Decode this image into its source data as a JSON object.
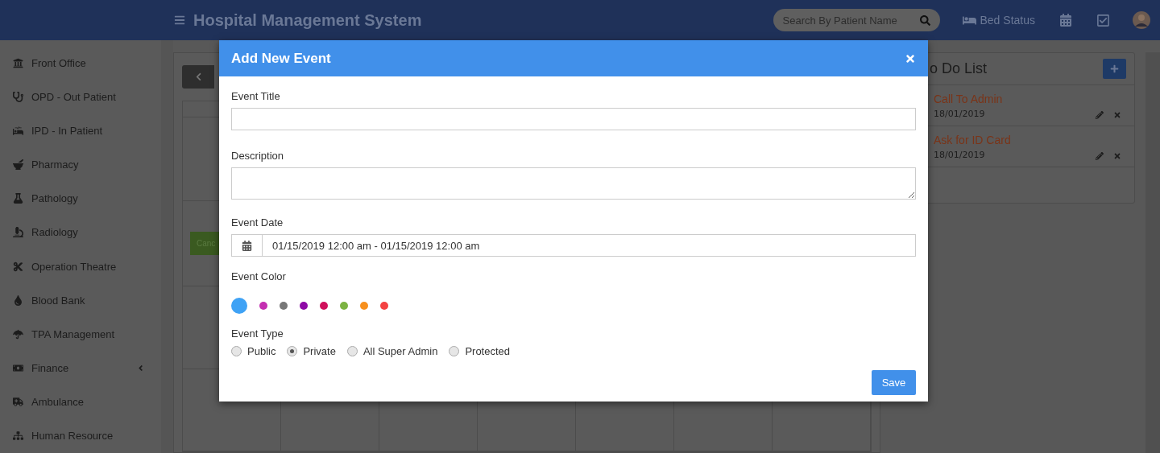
{
  "header": {
    "title": "Hospital Management System",
    "search": {
      "placeholder": "Search By Patient Name"
    },
    "bed_status": "Bed Status"
  },
  "sidebar": {
    "items": [
      {
        "label": "Front Office",
        "expandable": false
      },
      {
        "label": "OPD - Out Patient",
        "expandable": false
      },
      {
        "label": "IPD - In Patient",
        "expandable": false
      },
      {
        "label": "Pharmacy",
        "expandable": false
      },
      {
        "label": "Pathology",
        "expandable": false
      },
      {
        "label": "Radiology",
        "expandable": false
      },
      {
        "label": "Operation Theatre",
        "expandable": false
      },
      {
        "label": "Blood Bank",
        "expandable": false
      },
      {
        "label": "TPA Management",
        "expandable": false
      },
      {
        "label": "Finance",
        "expandable": true
      },
      {
        "label": "Ambulance",
        "expandable": false
      },
      {
        "label": "Human Resource",
        "expandable": false
      }
    ]
  },
  "calendar": {
    "event_button": "Canc"
  },
  "todo": {
    "title": "o Do List",
    "items": [
      {
        "title": "Call To Admin",
        "date": "18/01/2019"
      },
      {
        "title": "Ask for ID Card",
        "date": "18/01/2019"
      }
    ]
  },
  "modal": {
    "title": "Add New Event",
    "event_title": {
      "label": "Event Title"
    },
    "description": {
      "label": "Description"
    },
    "event_date": {
      "label": "Event Date",
      "value": "01/15/2019 12:00 am - 01/15/2019 12:00 am"
    },
    "event_color": {
      "label": "Event Color",
      "colors": [
        {
          "color": "#3fa2f5",
          "selected": true
        },
        {
          "color": "#c42fb1",
          "selected": false
        },
        {
          "color": "#777777",
          "selected": false
        },
        {
          "color": "#8e0aa6",
          "selected": false
        },
        {
          "color": "#d0105c",
          "selected": false
        },
        {
          "color": "#7cb342",
          "selected": false
        },
        {
          "color": "#f7901e",
          "selected": false
        },
        {
          "color": "#f44242",
          "selected": false
        }
      ]
    },
    "event_type": {
      "label": "Event Type",
      "options": [
        {
          "label": "Public",
          "selected": false
        },
        {
          "label": "Private",
          "selected": true
        },
        {
          "label": "All Super Admin",
          "selected": false
        },
        {
          "label": "Protected",
          "selected": false
        }
      ]
    },
    "save": "Save"
  }
}
